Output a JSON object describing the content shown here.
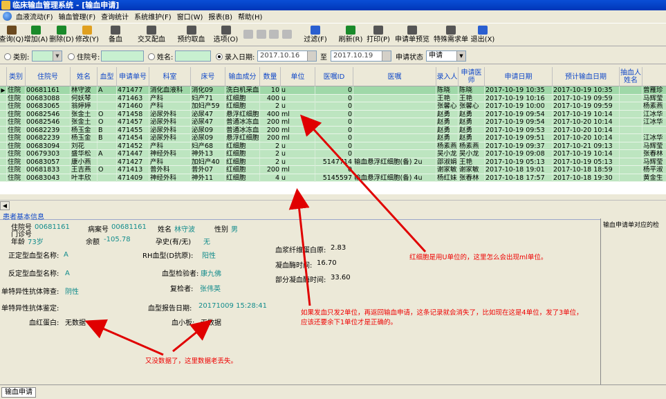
{
  "window": {
    "title": "临床输血管理系统 - [输血申请]"
  },
  "menu": {
    "items": [
      "血液流动(F)",
      "输血管理(F)",
      "查询统计",
      "系统维护(F)",
      "窗口(W)",
      "报表(B)",
      "帮助(H)"
    ]
  },
  "toolbar": {
    "buttons": [
      {
        "label": "查询(Q)",
        "icon": "search-icon",
        "color": "#6b4a1f",
        "w": 33
      },
      {
        "label": "增加(A)",
        "icon": "add-icon",
        "color": "#1a8a2a",
        "w": 38
      },
      {
        "label": "删除(D)",
        "icon": "delete-icon",
        "color": "#1a8a2a",
        "w": 36
      },
      {
        "label": "修改(Y)",
        "icon": "edit-icon",
        "color": "#e0a020",
        "w": 38
      },
      {
        "label": "备血",
        "icon": "blood-prep-icon",
        "color": "#555555",
        "w": 44
      },
      {
        "label": "交叉配血",
        "icon": "crossmatch-icon",
        "color": "#555555",
        "w": 60
      },
      {
        "label": "预约取血",
        "icon": "reserve-icon",
        "color": "#555555",
        "w": 55
      },
      {
        "label": "选项(O)",
        "icon": "options-icon",
        "color": "#555555",
        "w": 45
      },
      {
        "label": "",
        "icon": "first-icon",
        "color": "#bbbbbb",
        "w": 20,
        "disabled": true
      },
      {
        "label": "",
        "icon": "prev-icon",
        "color": "#bbbbbb",
        "w": 18,
        "disabled": true
      },
      {
        "label": "",
        "icon": "next-icon",
        "color": "#bbbbbb",
        "w": 18,
        "disabled": true
      },
      {
        "label": "",
        "icon": "last-icon",
        "color": "#bbbbbb",
        "w": 20,
        "disabled": true
      },
      {
        "label": "过滤(F)",
        "icon": "filter-icon",
        "color": "#2a5fd0",
        "w": 62
      },
      {
        "label": "刷新(R)",
        "icon": "refresh-icon",
        "color": "#1a8a2a",
        "w": 40
      },
      {
        "label": "打印(P)",
        "icon": "print-icon",
        "color": "#555555",
        "w": 40
      },
      {
        "label": "申请单预览",
        "icon": "preview-icon",
        "color": "#555555",
        "w": 58
      },
      {
        "label": "特殊需求单",
        "icon": "special-icon",
        "color": "#555555",
        "w": 54
      },
      {
        "label": "退出(X)",
        "icon": "exit-icon",
        "color": "#2a5fd0",
        "w": 38
      }
    ]
  },
  "filters": {
    "category_label": "类别:",
    "inpatient_label": "住院号:",
    "name_label": "姓名:",
    "date_label": "录入日期:",
    "date_from": "2017.10.16",
    "to_label": "至",
    "date_to": "2017.10.19",
    "status_label": "申请状态",
    "status_value": "申请"
  },
  "grid": {
    "columns": [
      "类别",
      "住院号",
      "姓名",
      "血型",
      "申请单号",
      "科室",
      "床号",
      "输血成分",
      "数量",
      "单位",
      "医嘱ID",
      "医嘱",
      "录入人",
      "申请医师",
      "申请日期",
      "预计输血日期",
      "抽血人姓名",
      "",
      ""
    ],
    "rows": [
      [
        "住院",
        "00681161",
        "林守波",
        "A",
        "471477",
        "消化血液科",
        "消化09",
        "洗白机采血",
        "10",
        "u",
        "0",
        "",
        "陈晓",
        "陈晓",
        "2017-10-19 10:35",
        "2017-10-19 10:35",
        "",
        "曾雁珍"
      ],
      [
        "住院",
        "00683088",
        "何妖琴",
        "",
        "471463",
        "产科",
        "妇产71",
        "红细胞",
        "400",
        "u",
        "0",
        "",
        "王艳",
        "王艳",
        "2017-10-19 10:16",
        "2017-10-19 09:59",
        "",
        "马辉莹"
      ],
      [
        "住院",
        "00683065",
        "翁婷婷",
        "",
        "471460",
        "产科",
        "加妇产59",
        "红细胞",
        "2",
        "u",
        "0",
        "",
        "张馨心",
        "张馨心",
        "2017-10-19 10:00",
        "2017-10-19 09:59",
        "",
        "杨素燕"
      ],
      [
        "住院",
        "00682546",
        "张金土",
        "O",
        "471458",
        "泌尿外科",
        "泌尿47",
        "悬浮红细胞",
        "400",
        "ml",
        "0",
        "",
        "赵勇",
        "赵勇",
        "2017-10-19 09:54",
        "2017-10-19 10:14",
        "",
        "江冰华"
      ],
      [
        "住院",
        "00682546",
        "张金土",
        "O",
        "471457",
        "泌尿外科",
        "泌尿47",
        "普通冰冻血",
        "200",
        "ml",
        "0",
        "",
        "赵勇",
        "赵勇",
        "2017-10-19 09:54",
        "2017-10-20 10:14",
        "",
        "江冰华"
      ],
      [
        "住院",
        "00682239",
        "杨玉金",
        "B",
        "471455",
        "泌尿外科",
        "泌尿09",
        "普通冰冻血",
        "200",
        "ml",
        "0",
        "",
        "赵勇",
        "赵勇",
        "2017-10-19 09:53",
        "2017-10-20 10:14",
        "",
        ""
      ],
      [
        "住院",
        "00682239",
        "杨玉金",
        "B",
        "471454",
        "泌尿外科",
        "泌尿09",
        "悬浮红细胞",
        "200",
        "ml",
        "0",
        "",
        "赵勇",
        "赵勇",
        "2017-10-19 09:51",
        "2017-10-20 10:14",
        "",
        "江冰华"
      ],
      [
        "住院",
        "00683094",
        "刘花",
        "",
        "471452",
        "产科",
        "妇产68",
        "红细胞",
        "2",
        "u",
        "0",
        "",
        "杨素燕",
        "杨素燕",
        "2017-10-19 09:37",
        "2017-10-21 09:13",
        "",
        "马辉莹"
      ],
      [
        "住院",
        "00679303",
        "盛华松",
        "A",
        "471447",
        "神经外科",
        "神外13",
        "红细胞",
        "2",
        "u",
        "0",
        "",
        "吴小龙",
        "吴小龙",
        "2017-10-19 09:08",
        "2017-10-19 10:14",
        "",
        "张春林"
      ],
      [
        "住院",
        "00683057",
        "康小燕",
        "",
        "471427",
        "产科",
        "加妇产40",
        "红细胞",
        "2",
        "u",
        "5147714",
        "输血悬浮红细胞(备) 2u",
        "邵淑娟",
        "王艳",
        "2017-10-19 05:13",
        "2017-10-19 05:13",
        "",
        "马辉莹"
      ],
      [
        "住院",
        "00681833",
        "王吉燕",
        "O",
        "471413",
        "普外科",
        "普外07",
        "红细胞",
        "200",
        "ml",
        "0",
        "",
        "谢家敏",
        "谢家敏",
        "2017-10-18 19:01",
        "2017-10-18 18:59",
        "",
        "杨平淑"
      ],
      [
        "住院",
        "00683043",
        "叶丰欣",
        "",
        "471409",
        "神经外科",
        "神外11",
        "红细胞",
        "4",
        "u",
        "5145597",
        "输血悬浮红细胞(备) 4u",
        "杨红妹",
        "张春林",
        "2017-10-18 17:57",
        "2017-10-18 19:30",
        "",
        "黄金生"
      ]
    ]
  },
  "patient": {
    "section_title": "患者基本信息",
    "inpatient_no_label": "住院号",
    "outpatient_no_label": "门诊号",
    "inpatient_no": "00681161",
    "case_no_label": "病案号",
    "case_no": "00681161",
    "name_label": "姓名",
    "name": "林守波",
    "sex_label": "性别",
    "sex": "男",
    "age_label": "年龄",
    "age": "73岁",
    "balance_label": "余额",
    "balance": "-105.78",
    "pregnancy_label": "孕史(有/无)",
    "pregnancy": "无",
    "forward_type_label": "正定型血型名称:",
    "forward_type": "A",
    "rh_label": "RH血型(D抗原):",
    "rh": "阳性",
    "reverse_type_label": "反定型血型名称:",
    "reverse_type": "A",
    "tester_label": "血型检验者:",
    "tester": "康九佛",
    "specific_screen_label": "单特异性抗体筛查:",
    "specific_screen": "阴性",
    "reviewer_label": "复检者:",
    "reviewer": "张伟英",
    "specific_id_label": "单特异性抗体鉴定:",
    "report_date_label": "血型报告日期:",
    "report_date": "20171009 15:28:41",
    "hemoglobin_label": "血红蛋白:",
    "hemoglobin": "无数据",
    "platelet_label": "血小板:",
    "platelet": "无数据",
    "fibrinogen_label": "血浆纤维蛋白原:",
    "fibrinogen": "2.83",
    "pt_label": "凝血酶时间:",
    "pt": "16.70",
    "aptt_label": "部分凝血酶时间:",
    "aptt": "33.60"
  },
  "right_panel": {
    "title": "输血申请单对应的检"
  },
  "annotations": {
    "note1": "红细胞是用U单位的，这里怎么会出现ml单位。",
    "note2_line1": "如果发血只发2单位，再返回输血申请，这条记录就会消失了，比如现在这是4单位，发了3单位，",
    "note2_line2": "应该还要余下1单位才是正确的。",
    "note3": "又没数据了，这里数据老丢失。",
    "color": "#e00000"
  },
  "status_tab": "输血申请"
}
